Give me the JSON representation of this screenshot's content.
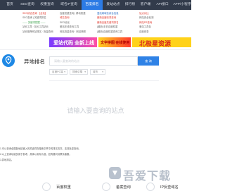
{
  "nav": {
    "items": [
      {
        "label": "首页",
        "active": false
      },
      {
        "label": "SEO查询",
        "active": false
      },
      {
        "label": "权重查询",
        "active": false
      },
      {
        "label": "域名IP查询",
        "active": false
      },
      {
        "label": "百度排名",
        "active": true
      },
      {
        "label": "爱站站点",
        "active": false
      },
      {
        "label": "排行榜",
        "active": false
      },
      {
        "label": "客户端",
        "active": false
      },
      {
        "label": "API接口",
        "active": false
      },
      {
        "label": "APP/小程序",
        "active": false
      }
    ]
  },
  "links": {
    "col1": [
      "SEO综合查询 【全站】",
      "SEO查询 | 关键词排名",
      "—— 关键词挖掘 ——",
      "站长工具 · 站长工具站长",
      "站长推荐网站排名 · 批量查询"
    ],
    "col2": [
      "百度权重查询 | 移动权重",
      "域名查询",
      "SEO优化",
      "爱站在线查询工具",
      "网站流量查询 · 网站快照"
    ],
    "col3": [
      "爱站网域名综合信息",
      "最新百度收录查询",
      "最新百度关键词排名",
      "(最新)手机百度权重",
      "(最新)百度权重查询工具"
    ],
    "col4": [
      "站点对比",
      "网站安全检测",
      "网站PR查询",
      "爱站工具包",
      "百度收录"
    ]
  },
  "banners": [
    {
      "text": "爱站代码 全新上线"
    },
    {
      "text": "文字拼图 在线使用"
    },
    {
      "text": "北极星资源"
    }
  ],
  "tool": {
    "title": "异地排名"
  },
  "search": {
    "placeholder": "请输入要查询的站点",
    "button": "查 询",
    "selects": [
      "百度PC端",
      "搜索引擎",
      "城市"
    ]
  },
  "result": {
    "placeholder": "请输入要查询的站点"
  },
  "notes": [
    "1.可以查询全国各地区输入的关键词在搜索引擎中的排名情况，支持批量查询。",
    "2.以上查询功能仅用于参考，具体以实际为准，如有疑问请联系客服。",
    "3.异地排名。"
  ],
  "features": [
    {
      "label": "百度权重"
    },
    {
      "label": "备案查询"
    },
    {
      "label": "IP反查域名"
    }
  ],
  "watermark": {
    "text": "吾爱下载"
  },
  "colors": {
    "nav_bg": "#323b4b",
    "accent": "#2c7be5",
    "button": "#2f82e6"
  }
}
